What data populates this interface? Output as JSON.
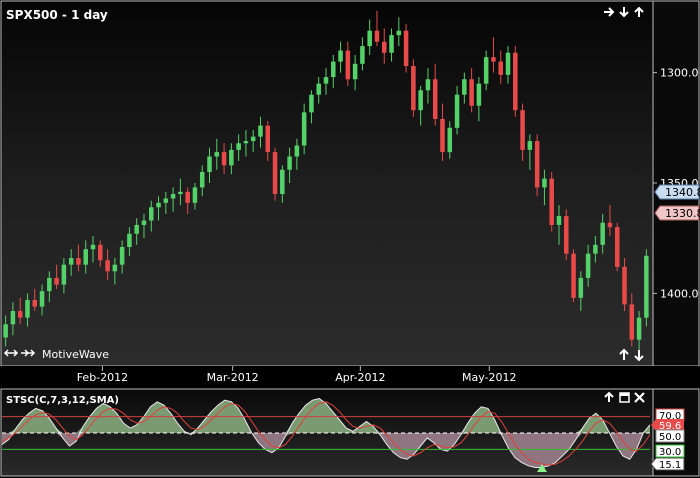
{
  "window": {
    "title": "SPX500 - 1 day",
    "brand": "MotiveWave",
    "nav_icons": [
      "arrow-right-icon",
      "arrow-down-icon",
      "arrow-up-icon"
    ],
    "scroll_icons": [
      "arrow-up-icon",
      "arrow-down-icon"
    ],
    "indicator_controls": [
      "arrow-up-icon",
      "maximize-icon",
      "close-icon"
    ]
  },
  "colors": {
    "bull": "#55d16a",
    "bear": "#e84a4a",
    "wick": "#d8d8d8",
    "price_label_blue": "#c9dcf0",
    "price_label_red": "#f0c6c6",
    "osc_fill_upper": "#7a9a72",
    "osc_fill_lower": "#8f7580",
    "signal_line": "#e0403a",
    "band_line_upper": "#d04040",
    "band_line_lower": "#30c030"
  },
  "price_axis": {
    "ticks": [
      "1400.0",
      "1350.0",
      "1300.0"
    ],
    "last_price": "1340.8",
    "prev_price": "1330.8"
  },
  "time_axis": {
    "labels": [
      "Feb-2012",
      "Mar-2012",
      "Apr-2012",
      "May-2012"
    ]
  },
  "indicator": {
    "title": "STSC(C,7,3,12,SMA)",
    "levels": [
      "70.0",
      "30.0"
    ],
    "mid_level": "50.0",
    "current_value": "59.6",
    "signal_value": "15.1"
  },
  "chart_data": [
    {
      "type": "candlestick",
      "symbol": "SPX500",
      "interval": "1 day",
      "ylim": [
        1268,
        1432
      ],
      "yticks": [
        1300,
        1350,
        1400
      ],
      "x_labels": [
        "Feb-2012",
        "Mar-2012",
        "Apr-2012",
        "May-2012"
      ],
      "grid": false,
      "ohlc": [
        [
          1280,
          1290,
          1276,
          1286
        ],
        [
          1286,
          1296,
          1281,
          1292
        ],
        [
          1292,
          1298,
          1286,
          1289
        ],
        [
          1289,
          1300,
          1285,
          1297
        ],
        [
          1297,
          1302,
          1292,
          1294
        ],
        [
          1294,
          1304,
          1290,
          1301
        ],
        [
          1301,
          1310,
          1296,
          1307
        ],
        [
          1307,
          1313,
          1302,
          1304
        ],
        [
          1304,
          1316,
          1300,
          1313
        ],
        [
          1313,
          1320,
          1308,
          1316
        ],
        [
          1316,
          1322,
          1310,
          1313
        ],
        [
          1313,
          1324,
          1309,
          1320
        ],
        [
          1320,
          1326,
          1314,
          1322
        ],
        [
          1322,
          1324,
          1312,
          1315
        ],
        [
          1315,
          1320,
          1306,
          1310
        ],
        [
          1310,
          1316,
          1304,
          1313
        ],
        [
          1313,
          1324,
          1309,
          1321
        ],
        [
          1321,
          1330,
          1317,
          1327
        ],
        [
          1327,
          1334,
          1322,
          1331
        ],
        [
          1331,
          1336,
          1325,
          1333
        ],
        [
          1333,
          1342,
          1328,
          1339
        ],
        [
          1339,
          1344,
          1333,
          1341
        ],
        [
          1341,
          1346,
          1336,
          1343
        ],
        [
          1343,
          1348,
          1337,
          1345
        ],
        [
          1345,
          1352,
          1340,
          1346
        ],
        [
          1346,
          1348,
          1336,
          1341
        ],
        [
          1341,
          1350,
          1338,
          1348
        ],
        [
          1348,
          1358,
          1344,
          1355
        ],
        [
          1355,
          1366,
          1350,
          1362
        ],
        [
          1362,
          1370,
          1356,
          1364
        ],
        [
          1364,
          1368,
          1354,
          1358
        ],
        [
          1358,
          1368,
          1354,
          1365
        ],
        [
          1365,
          1372,
          1360,
          1368
        ],
        [
          1368,
          1374,
          1362,
          1369
        ],
        [
          1369,
          1374,
          1364,
          1371
        ],
        [
          1371,
          1380,
          1366,
          1376
        ],
        [
          1376,
          1378,
          1360,
          1364
        ],
        [
          1364,
          1366,
          1342,
          1345
        ],
        [
          1345,
          1358,
          1341,
          1356
        ],
        [
          1356,
          1366,
          1350,
          1362
        ],
        [
          1362,
          1370,
          1356,
          1367
        ],
        [
          1367,
          1386,
          1363,
          1382
        ],
        [
          1382,
          1392,
          1377,
          1390
        ],
        [
          1390,
          1398,
          1386,
          1395
        ],
        [
          1395,
          1402,
          1390,
          1398
        ],
        [
          1398,
          1408,
          1393,
          1405
        ],
        [
          1405,
          1414,
          1400,
          1410
        ],
        [
          1410,
          1414,
          1394,
          1397
        ],
        [
          1397,
          1408,
          1392,
          1404
        ],
        [
          1404,
          1416,
          1401,
          1412
        ],
        [
          1412,
          1424,
          1408,
          1419
        ],
        [
          1419,
          1428,
          1412,
          1414
        ],
        [
          1414,
          1420,
          1404,
          1409
        ],
        [
          1409,
          1420,
          1405,
          1417
        ],
        [
          1417,
          1425,
          1412,
          1419
        ],
        [
          1419,
          1422,
          1400,
          1403
        ],
        [
          1403,
          1406,
          1380,
          1383
        ],
        [
          1383,
          1394,
          1376,
          1392
        ],
        [
          1392,
          1402,
          1386,
          1397
        ],
        [
          1397,
          1404,
          1376,
          1379
        ],
        [
          1379,
          1386,
          1360,
          1364
        ],
        [
          1364,
          1378,
          1361,
          1375
        ],
        [
          1375,
          1394,
          1372,
          1390
        ],
        [
          1390,
          1400,
          1386,
          1397
        ],
        [
          1397,
          1402,
          1382,
          1385
        ],
        [
          1385,
          1398,
          1378,
          1395
        ],
        [
          1395,
          1410,
          1392,
          1407
        ],
        [
          1407,
          1416,
          1400,
          1405
        ],
        [
          1405,
          1410,
          1395,
          1399
        ],
        [
          1399,
          1412,
          1395,
          1409
        ],
        [
          1409,
          1412,
          1380,
          1383
        ],
        [
          1383,
          1386,
          1360,
          1365
        ],
        [
          1365,
          1372,
          1356,
          1369
        ],
        [
          1369,
          1372,
          1344,
          1348
        ],
        [
          1348,
          1356,
          1340,
          1352
        ],
        [
          1352,
          1355,
          1328,
          1331
        ],
        [
          1331,
          1340,
          1322,
          1335
        ],
        [
          1335,
          1338,
          1315,
          1318
        ],
        [
          1318,
          1320,
          1296,
          1298
        ],
        [
          1298,
          1310,
          1292,
          1307
        ],
        [
          1307,
          1322,
          1303,
          1318
        ],
        [
          1318,
          1326,
          1314,
          1322
        ],
        [
          1322,
          1336,
          1318,
          1332
        ],
        [
          1332,
          1340,
          1326,
          1330
        ],
        [
          1330,
          1332,
          1310,
          1312
        ],
        [
          1312,
          1316,
          1292,
          1295
        ],
        [
          1295,
          1300,
          1276,
          1279
        ],
        [
          1279,
          1292,
          1272,
          1289
        ],
        [
          1289,
          1320,
          1285,
          1317
        ]
      ]
    },
    {
      "type": "area",
      "title": "STSC(C,7,3,12,SMA)",
      "ylim": [
        0,
        100
      ],
      "levels": [
        70,
        30
      ],
      "mid": 50,
      "series": [
        {
          "values": [
            36,
            42,
            55,
            66,
            74,
            80,
            77,
            68,
            56,
            44,
            34,
            40,
            58,
            70,
            80,
            86,
            82,
            74,
            62,
            56,
            60,
            70,
            82,
            88,
            84,
            74,
            62,
            52,
            48,
            56,
            66,
            76,
            84,
            90,
            88,
            80,
            66,
            50,
            38,
            30,
            26,
            32,
            46,
            62,
            74,
            84,
            90,
            92,
            86,
            76,
            66,
            56,
            52,
            58,
            64,
            58,
            48,
            36,
            26,
            20,
            18,
            24,
            34,
            44,
            38,
            30,
            28,
            36,
            48,
            62,
            74,
            82,
            80,
            66,
            48,
            32,
            20,
            14,
            10,
            8,
            8,
            10,
            14,
            22,
            30,
            42,
            56,
            68,
            74,
            66,
            50,
            34,
            22,
            18,
            30,
            50,
            60
          ]
        },
        {
          "values": [
            40,
            44,
            50,
            58,
            66,
            72,
            75,
            73,
            66,
            56,
            46,
            42,
            48,
            58,
            68,
            76,
            80,
            79,
            74,
            66,
            62,
            64,
            70,
            78,
            82,
            80,
            74,
            64,
            56,
            54,
            58,
            66,
            74,
            82,
            86,
            84,
            76,
            64,
            52,
            42,
            34,
            32,
            36,
            46,
            58,
            70,
            80,
            86,
            88,
            84,
            76,
            66,
            58,
            56,
            58,
            60,
            56,
            48,
            38,
            30,
            24,
            22,
            26,
            32,
            36,
            34,
            32,
            33,
            38,
            48,
            60,
            70,
            76,
            74,
            64,
            50,
            36,
            26,
            18,
            14,
            12,
            11,
            12,
            16,
            22,
            30,
            40,
            52,
            62,
            66,
            62,
            52,
            40,
            30,
            28,
            36,
            48
          ]
        }
      ]
    }
  ]
}
